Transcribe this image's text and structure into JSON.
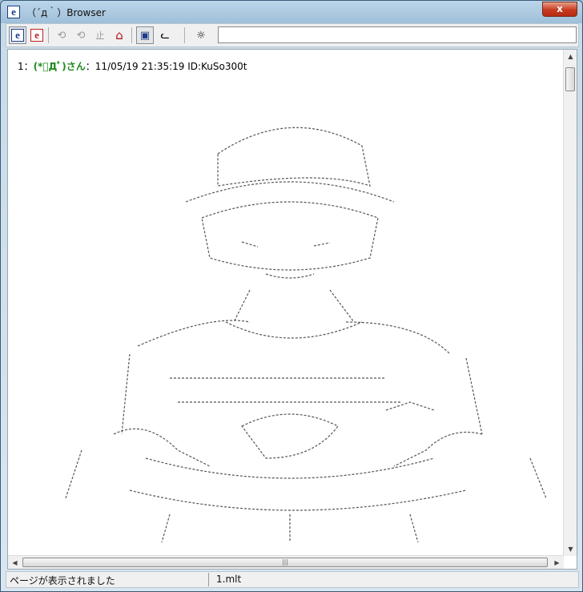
{
  "window": {
    "title": "（´д｀）Browser",
    "close_glyph": "x"
  },
  "toolbar": {
    "buttons": [
      {
        "icon": "ie-blue-icon",
        "glyph": "e"
      },
      {
        "icon": "ie-red-icon",
        "glyph": "e"
      },
      {
        "icon": "refresh-icon",
        "glyph": "⟲"
      },
      {
        "icon": "refresh-all-icon",
        "glyph": "⟲"
      },
      {
        "icon": "stop-icon",
        "glyph": "止"
      },
      {
        "icon": "home-icon",
        "glyph": "⌂"
      },
      {
        "icon": "view-icon",
        "glyph": "▣"
      },
      {
        "icon": "cat-icon",
        "glyph": "ᓚ"
      },
      {
        "icon": "search-cat-icon",
        "glyph": "☼"
      }
    ],
    "address_value": ""
  },
  "post": {
    "number": "1",
    "separator": "：",
    "name": "(*ﾟДﾟ)さん",
    "meta": "：11/05/19 21:35:19 ID:KuSo300t"
  },
  "status": {
    "message": "ページが表示されました",
    "file": "1.mlt"
  }
}
